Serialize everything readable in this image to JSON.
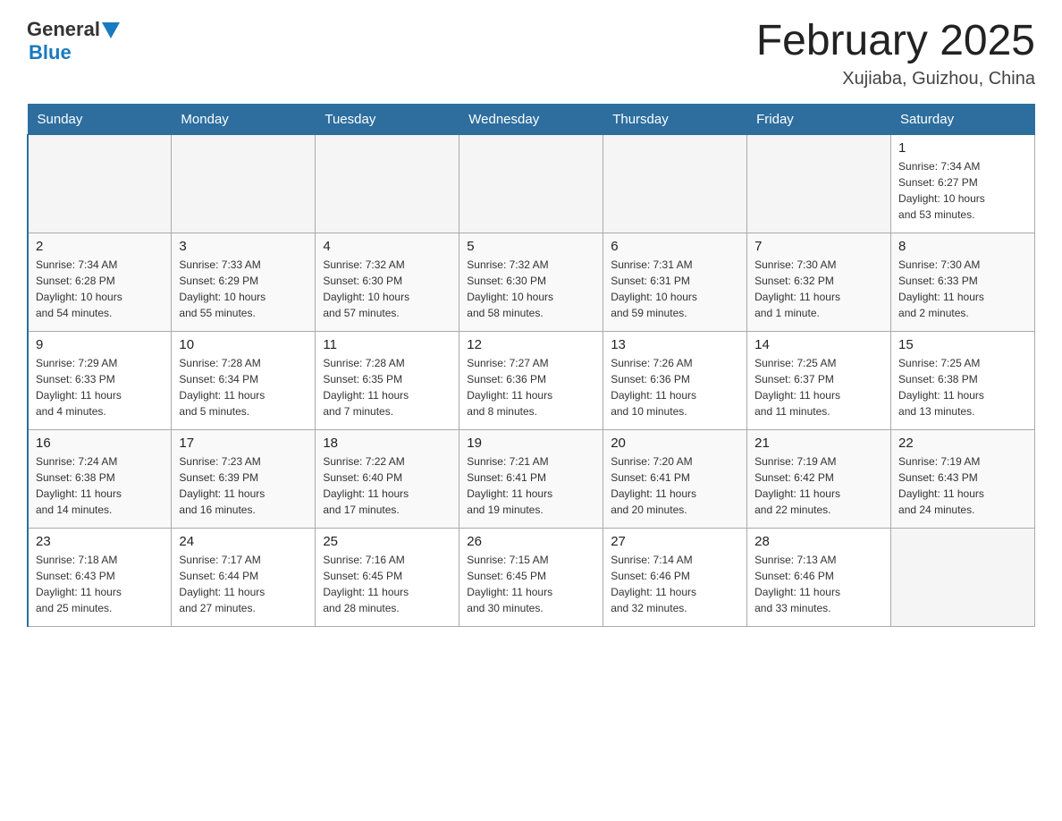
{
  "header": {
    "logo_general": "General",
    "logo_blue": "Blue",
    "title": "February 2025",
    "subtitle": "Xujiaba, Guizhou, China"
  },
  "weekdays": [
    "Sunday",
    "Monday",
    "Tuesday",
    "Wednesday",
    "Thursday",
    "Friday",
    "Saturday"
  ],
  "weeks": [
    [
      {
        "day": "",
        "info": ""
      },
      {
        "day": "",
        "info": ""
      },
      {
        "day": "",
        "info": ""
      },
      {
        "day": "",
        "info": ""
      },
      {
        "day": "",
        "info": ""
      },
      {
        "day": "",
        "info": ""
      },
      {
        "day": "1",
        "info": "Sunrise: 7:34 AM\nSunset: 6:27 PM\nDaylight: 10 hours\nand 53 minutes."
      }
    ],
    [
      {
        "day": "2",
        "info": "Sunrise: 7:34 AM\nSunset: 6:28 PM\nDaylight: 10 hours\nand 54 minutes."
      },
      {
        "day": "3",
        "info": "Sunrise: 7:33 AM\nSunset: 6:29 PM\nDaylight: 10 hours\nand 55 minutes."
      },
      {
        "day": "4",
        "info": "Sunrise: 7:32 AM\nSunset: 6:30 PM\nDaylight: 10 hours\nand 57 minutes."
      },
      {
        "day": "5",
        "info": "Sunrise: 7:32 AM\nSunset: 6:30 PM\nDaylight: 10 hours\nand 58 minutes."
      },
      {
        "day": "6",
        "info": "Sunrise: 7:31 AM\nSunset: 6:31 PM\nDaylight: 10 hours\nand 59 minutes."
      },
      {
        "day": "7",
        "info": "Sunrise: 7:30 AM\nSunset: 6:32 PM\nDaylight: 11 hours\nand 1 minute."
      },
      {
        "day": "8",
        "info": "Sunrise: 7:30 AM\nSunset: 6:33 PM\nDaylight: 11 hours\nand 2 minutes."
      }
    ],
    [
      {
        "day": "9",
        "info": "Sunrise: 7:29 AM\nSunset: 6:33 PM\nDaylight: 11 hours\nand 4 minutes."
      },
      {
        "day": "10",
        "info": "Sunrise: 7:28 AM\nSunset: 6:34 PM\nDaylight: 11 hours\nand 5 minutes."
      },
      {
        "day": "11",
        "info": "Sunrise: 7:28 AM\nSunset: 6:35 PM\nDaylight: 11 hours\nand 7 minutes."
      },
      {
        "day": "12",
        "info": "Sunrise: 7:27 AM\nSunset: 6:36 PM\nDaylight: 11 hours\nand 8 minutes."
      },
      {
        "day": "13",
        "info": "Sunrise: 7:26 AM\nSunset: 6:36 PM\nDaylight: 11 hours\nand 10 minutes."
      },
      {
        "day": "14",
        "info": "Sunrise: 7:25 AM\nSunset: 6:37 PM\nDaylight: 11 hours\nand 11 minutes."
      },
      {
        "day": "15",
        "info": "Sunrise: 7:25 AM\nSunset: 6:38 PM\nDaylight: 11 hours\nand 13 minutes."
      }
    ],
    [
      {
        "day": "16",
        "info": "Sunrise: 7:24 AM\nSunset: 6:38 PM\nDaylight: 11 hours\nand 14 minutes."
      },
      {
        "day": "17",
        "info": "Sunrise: 7:23 AM\nSunset: 6:39 PM\nDaylight: 11 hours\nand 16 minutes."
      },
      {
        "day": "18",
        "info": "Sunrise: 7:22 AM\nSunset: 6:40 PM\nDaylight: 11 hours\nand 17 minutes."
      },
      {
        "day": "19",
        "info": "Sunrise: 7:21 AM\nSunset: 6:41 PM\nDaylight: 11 hours\nand 19 minutes."
      },
      {
        "day": "20",
        "info": "Sunrise: 7:20 AM\nSunset: 6:41 PM\nDaylight: 11 hours\nand 20 minutes."
      },
      {
        "day": "21",
        "info": "Sunrise: 7:19 AM\nSunset: 6:42 PM\nDaylight: 11 hours\nand 22 minutes."
      },
      {
        "day": "22",
        "info": "Sunrise: 7:19 AM\nSunset: 6:43 PM\nDaylight: 11 hours\nand 24 minutes."
      }
    ],
    [
      {
        "day": "23",
        "info": "Sunrise: 7:18 AM\nSunset: 6:43 PM\nDaylight: 11 hours\nand 25 minutes."
      },
      {
        "day": "24",
        "info": "Sunrise: 7:17 AM\nSunset: 6:44 PM\nDaylight: 11 hours\nand 27 minutes."
      },
      {
        "day": "25",
        "info": "Sunrise: 7:16 AM\nSunset: 6:45 PM\nDaylight: 11 hours\nand 28 minutes."
      },
      {
        "day": "26",
        "info": "Sunrise: 7:15 AM\nSunset: 6:45 PM\nDaylight: 11 hours\nand 30 minutes."
      },
      {
        "day": "27",
        "info": "Sunrise: 7:14 AM\nSunset: 6:46 PM\nDaylight: 11 hours\nand 32 minutes."
      },
      {
        "day": "28",
        "info": "Sunrise: 7:13 AM\nSunset: 6:46 PM\nDaylight: 11 hours\nand 33 minutes."
      },
      {
        "day": "",
        "info": ""
      }
    ]
  ]
}
